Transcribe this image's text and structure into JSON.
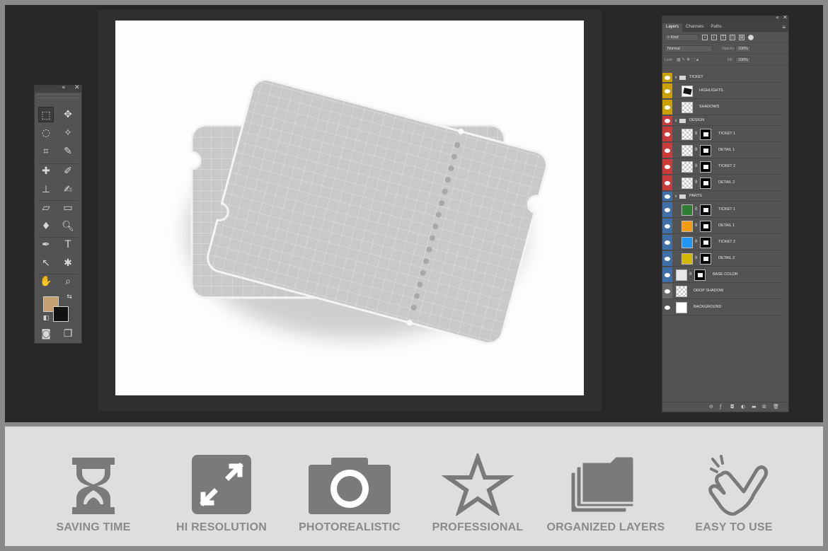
{
  "app": {
    "accent_colors": {
      "workspace": "#282828",
      "panel": "#535353",
      "strip": "#dedede",
      "icon_gray": "#7a7a7a"
    }
  },
  "toolbox": {
    "collapse": "«",
    "close": "✕",
    "foreground_color": "#c4a070",
    "background_color": "#111111",
    "tools": [
      {
        "icon": "marquee-icon",
        "glyph": "⬚"
      },
      {
        "icon": "move-icon",
        "glyph": "✥"
      },
      {
        "icon": "lasso-icon",
        "glyph": "◌"
      },
      {
        "icon": "magic-wand-icon",
        "glyph": "✧"
      },
      {
        "icon": "crop-icon",
        "glyph": "⌗"
      },
      {
        "icon": "eyedropper-icon",
        "glyph": "✎"
      },
      {
        "icon": "healing-brush-icon",
        "glyph": "✚"
      },
      {
        "icon": "brush-icon",
        "glyph": "✐"
      },
      {
        "icon": "stamp-icon",
        "glyph": "⊥"
      },
      {
        "icon": "history-brush-icon",
        "glyph": "✍"
      },
      {
        "icon": "eraser-icon",
        "glyph": "▱"
      },
      {
        "icon": "gradient-icon",
        "glyph": "▭"
      },
      {
        "icon": "blur-icon",
        "glyph": "♦"
      },
      {
        "icon": "dodge-icon",
        "glyph": "🔍︎"
      },
      {
        "icon": "pen-icon",
        "glyph": "✒"
      },
      {
        "icon": "type-icon",
        "glyph": "T"
      },
      {
        "icon": "path-selection-icon",
        "glyph": "↖"
      },
      {
        "icon": "shape-icon",
        "glyph": "✱"
      },
      {
        "icon": "hand-icon",
        "glyph": "✋"
      },
      {
        "icon": "zoom-icon",
        "glyph": "⌕"
      }
    ],
    "bottom_tools": [
      {
        "icon": "quick-mask-icon",
        "glyph": "◙"
      },
      {
        "icon": "screen-mode-icon",
        "glyph": "❐"
      }
    ]
  },
  "layers_panel": {
    "collapse": "«",
    "close": "✕",
    "menu": "≡",
    "tabs": [
      {
        "label": "Layers",
        "active": true
      },
      {
        "label": "Channels",
        "active": false
      },
      {
        "label": "Paths",
        "active": false
      }
    ],
    "filter_kind": "Kind",
    "blend_mode": "Normal",
    "opacity_label": "Opacity:",
    "opacity_value": "100%",
    "lock_label": "Lock:",
    "fill_label": "Fill:",
    "fill_value": "100%",
    "layers": [
      {
        "name": "TICKET",
        "type": "group",
        "color": "#c9a000",
        "indent": 0
      },
      {
        "name": "HIGHLIGHTS",
        "type": "layer",
        "color": "#c9a000",
        "indent": 1,
        "thumb": "dark",
        "mask": false
      },
      {
        "name": "SHADOWS",
        "type": "layer",
        "color": "#c9a000",
        "indent": 1,
        "thumb": "checker",
        "mask": false
      },
      {
        "name": "DESIGN",
        "type": "group",
        "color": "#cc3b3b",
        "indent": 0
      },
      {
        "name": "TICKET 1",
        "type": "layer",
        "color": "#cc3b3b",
        "indent": 1,
        "thumb": "checker",
        "mask": true
      },
      {
        "name": "DETAIL 1",
        "type": "layer",
        "color": "#cc3b3b",
        "indent": 1,
        "thumb": "checker",
        "mask": true
      },
      {
        "name": "TICKET 2",
        "type": "layer",
        "color": "#cc3b3b",
        "indent": 1,
        "thumb": "checker",
        "mask": true
      },
      {
        "name": "DETAIL 2",
        "type": "layer",
        "color": "#cc3b3b",
        "indent": 1,
        "thumb": "checker",
        "mask": true
      },
      {
        "name": "PARTS",
        "type": "group",
        "color": "#3f6ea8",
        "indent": 0
      },
      {
        "name": "TICKET 1",
        "type": "layer",
        "color": "#3f6ea8",
        "indent": 1,
        "thumb": "#2e7d32",
        "mask": true
      },
      {
        "name": "DETAIL 1",
        "type": "layer",
        "color": "#3f6ea8",
        "indent": 1,
        "thumb": "#f39c12",
        "mask": true
      },
      {
        "name": "TICKET 2",
        "type": "layer",
        "color": "#3f6ea8",
        "indent": 1,
        "thumb": "#2196f3",
        "mask": true
      },
      {
        "name": "DETAIL 2",
        "type": "layer",
        "color": "#3f6ea8",
        "indent": 1,
        "thumb": "#d4b800",
        "mask": true
      },
      {
        "name": "BASE COLOR",
        "type": "layer",
        "color": "#3f6ea8",
        "indent": 0,
        "thumb": "#e8e8e8",
        "mask": true
      },
      {
        "name": "DROP SHADOW",
        "type": "layer",
        "color": "#6a6a6a",
        "indent": 0,
        "thumb": "checker",
        "mask": false
      },
      {
        "name": "BACKGROUND",
        "type": "layer",
        "color": "#535353",
        "indent": 0,
        "thumb": "#ffffff",
        "mask": false
      }
    ],
    "footer_icons": [
      {
        "icon": "link-layers-icon",
        "glyph": "⊖"
      },
      {
        "icon": "fx-icon",
        "glyph": "ƒ"
      },
      {
        "icon": "add-mask-icon",
        "glyph": "◘"
      },
      {
        "icon": "adjustment-icon",
        "glyph": "◐"
      },
      {
        "icon": "new-group-icon",
        "glyph": "▬"
      },
      {
        "icon": "new-layer-icon",
        "glyph": "⊞"
      },
      {
        "icon": "delete-layer-icon",
        "glyph": "🗑︎"
      }
    ]
  },
  "features": [
    {
      "label": "SAVING TIME",
      "icon": "hourglass-icon"
    },
    {
      "label": "HI RESOLUTION",
      "icon": "expand-icon"
    },
    {
      "label": "PHOTOREALISTIC",
      "icon": "camera-icon"
    },
    {
      "label": "PROFESSIONAL",
      "icon": "star-icon"
    },
    {
      "label": "ORGANIZED LAYERS",
      "icon": "folders-icon"
    },
    {
      "label": "EASY TO USE",
      "icon": "pointing-hand-icon"
    }
  ]
}
